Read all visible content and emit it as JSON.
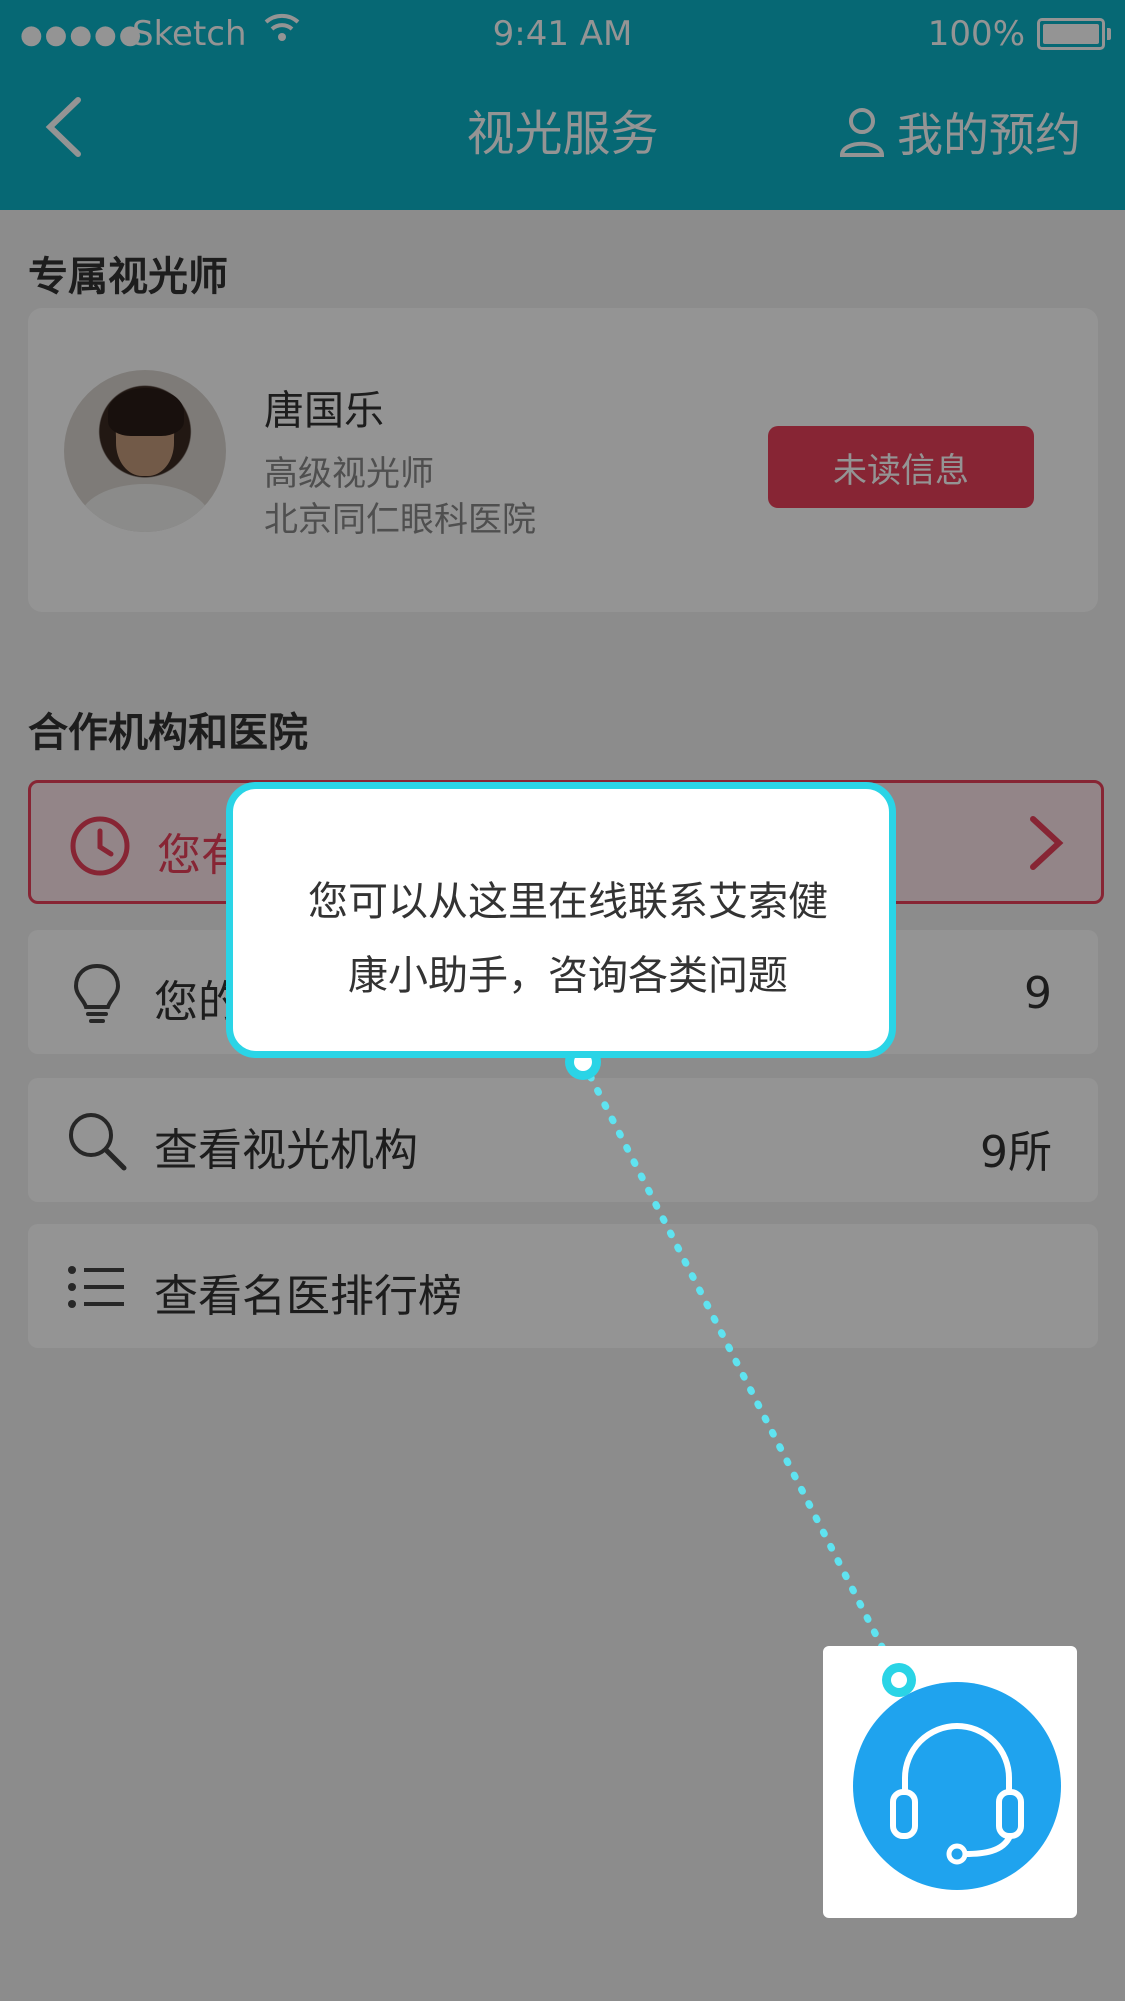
{
  "status_bar": {
    "carrier": "Sketch",
    "time": "9:41 AM",
    "battery": "100%"
  },
  "nav": {
    "title": "视光服务",
    "my_appointments": "我的预约"
  },
  "optometrist_section": {
    "title": "专属视光师",
    "name": "唐国乐",
    "position": "高级视光师",
    "hospital": "北京同仁眼科医院",
    "unread_button": "未读信息"
  },
  "partner_section": {
    "title": "合作机构和医院",
    "alert_row": {
      "label": "您有"
    },
    "tips_row": {
      "label": "您的",
      "value": "9"
    },
    "institutions_row": {
      "label": "查看视光机构",
      "value": "9所"
    },
    "ranking_row": {
      "label": "查看名医排行榜"
    }
  },
  "tooltip": {
    "line1": "您可以从这里在线联系艾索健",
    "line2": "康小助手，咨询各类问题"
  },
  "colors": {
    "primary": "#0bb3c9",
    "alert": "#e8415a",
    "tooltip_border": "#2ad4e6",
    "support_button": "#1fa3ee"
  }
}
